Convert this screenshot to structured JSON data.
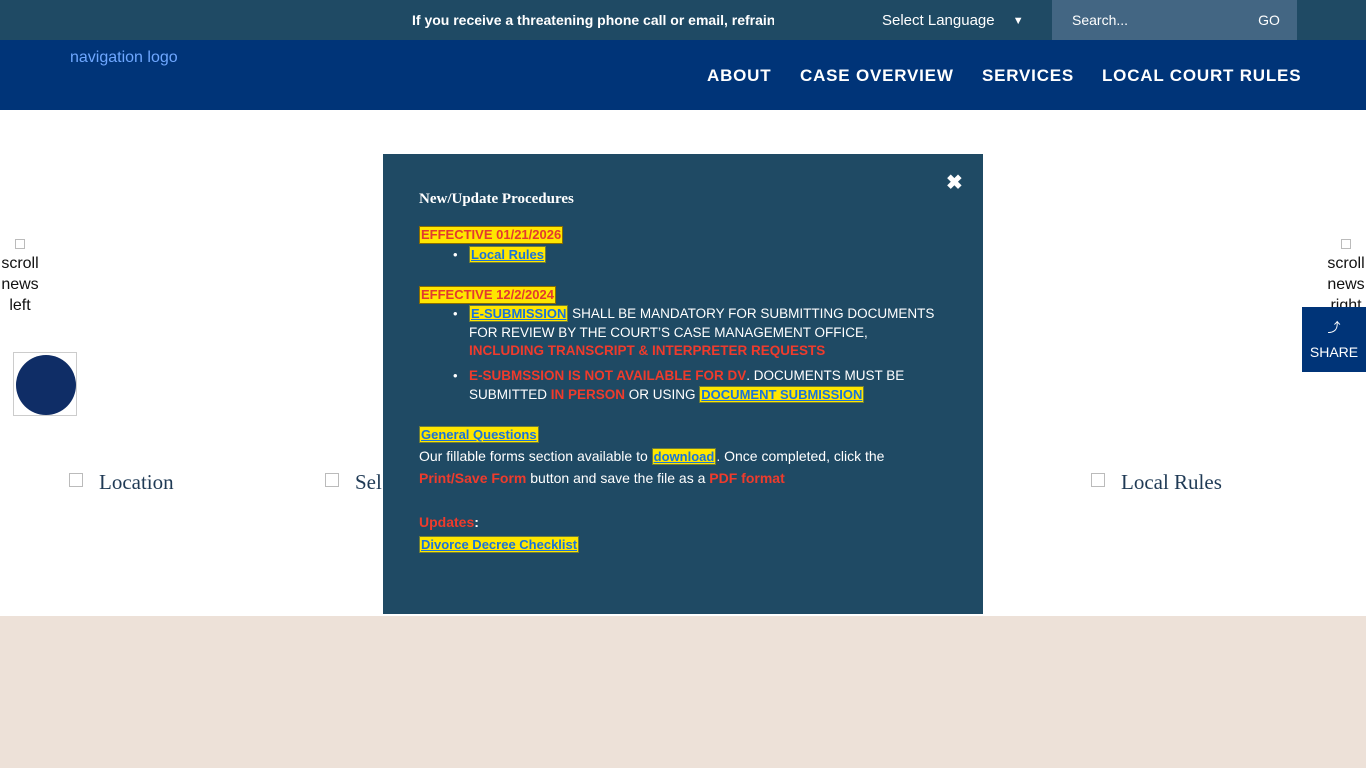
{
  "topbar": {
    "ticker": "If you receive a threatening phone call or email, refrain from",
    "language_label": "Select Language",
    "language_caret": "▼",
    "search_placeholder": "Search...",
    "go_label": "GO"
  },
  "nav": {
    "logo_alt": "navigation logo",
    "links": [
      "ABOUT",
      "CASE OVERVIEW",
      "SERVICES",
      "LOCAL COURT RULES"
    ]
  },
  "hero": {
    "scroll_left_alt": "scroll news left",
    "scroll_right_alt": "scroll news right",
    "share_icon": "⤴",
    "share_label": "SHARE"
  },
  "quick_links": {
    "location": "Location",
    "second": "Sel",
    "local_rules": "Local Rules"
  },
  "modal": {
    "close": "✖",
    "title": "New/Update Procedures",
    "effective_1": "EFFECTIVE  01/21/2026",
    "local_rules_link": "Local Rules",
    "effective_2": "EFFECTIVE  12/2/2024",
    "esub_link": "E-SUBMISSION",
    "esub_text_1": " SHALL BE MANDATORY FOR SUBMITTING DOCUMENTS FOR REVIEW BY THE COURT’S CASE MANAGEMENT OFFICE, ",
    "esub_red": "INCLUDING TRANSCRIPT & INTERPRETER REQUESTS",
    "dv_red": "E-SUBMSSION IS NOT AVAILABLE FOR DV",
    "dv_text_1": ". DOCUMENTS MUST BE SUBMITTED ",
    "dv_red_2": "IN PERSON",
    "dv_text_2": " OR USING ",
    "doc_sub_link": "DOCUMENT SUBMISSION",
    "general_link": "General Questions",
    "forms_text_1": "Our fillable forms section available to ",
    "download_link": "download",
    "forms_text_2": ". Once completed, click the ",
    "print_red": "Print/Save Form",
    "forms_text_3": " button and save the file as a ",
    "pdf_red": "PDF format",
    "updates_red": "Updates",
    "updates_colon": ":",
    "divorce_link": "Divorce Decree Checklist"
  },
  "colors": {
    "topbar": "#1f4a64",
    "nav": "#003478",
    "modal": "#1f4a64",
    "highlight": "#ffe600",
    "alert_red": "#ef3b2c",
    "footer": "#ede1d8"
  }
}
